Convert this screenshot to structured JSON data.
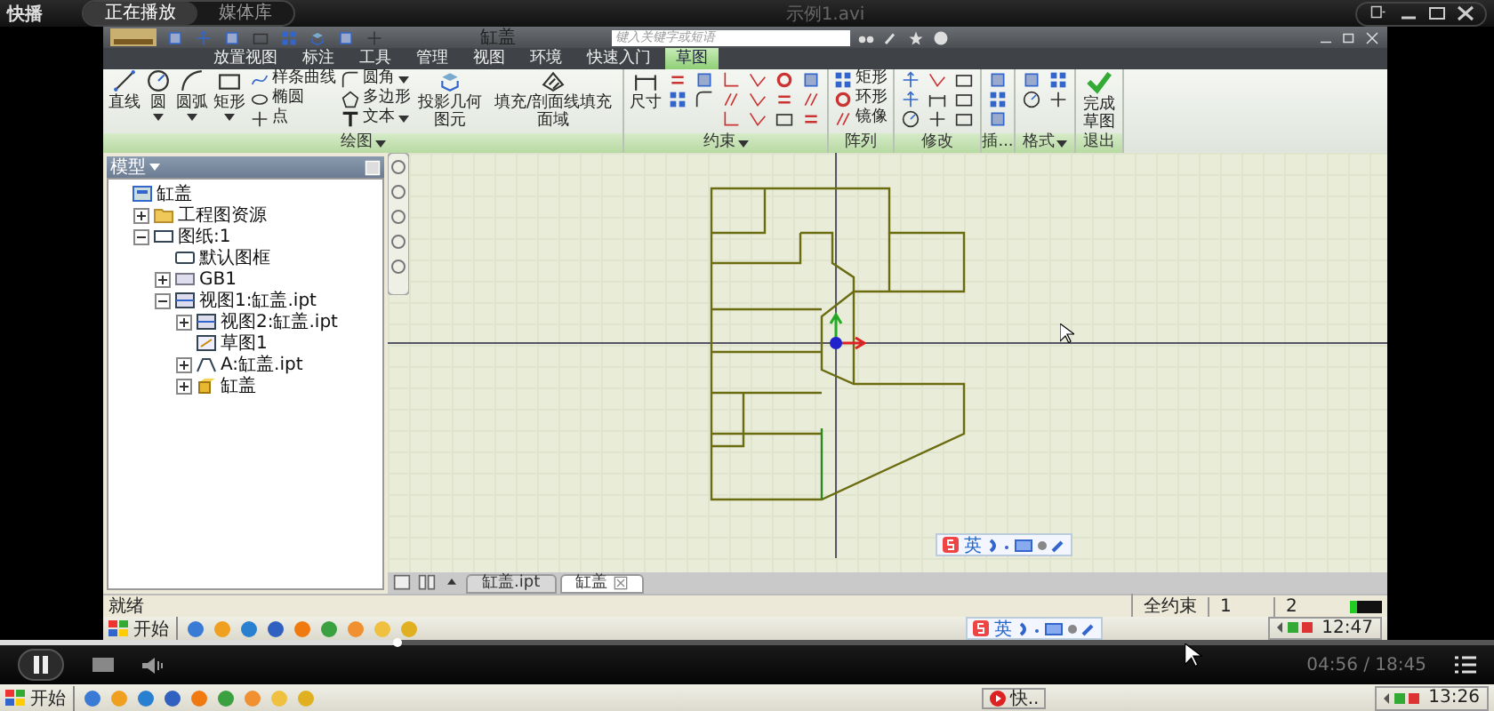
{
  "player": {
    "logo": "快播",
    "tabs": [
      {
        "label": "正在播放",
        "selected": true
      },
      {
        "label": "媒体库",
        "selected": false
      }
    ],
    "title": "示例1.avi"
  },
  "app": {
    "title": "缸盖",
    "search": {
      "placeholder": "键入关键字或短语"
    },
    "ribbon_tabs": [
      {
        "label": "放置视图",
        "selected": false
      },
      {
        "label": "标注",
        "selected": false
      },
      {
        "label": "工具",
        "selected": false
      },
      {
        "label": "管理",
        "selected": false
      },
      {
        "label": "视图",
        "selected": false
      },
      {
        "label": "环境",
        "selected": false
      },
      {
        "label": "快速入门",
        "selected": false
      },
      {
        "label": "草图",
        "selected": true
      }
    ],
    "ribbon_groups": [
      {
        "kind": "draw",
        "label": "绘图",
        "menu": true,
        "tools": [
          {
            "kind": "large",
            "label": "直线",
            "menu": false
          },
          {
            "kind": "large",
            "label": "圆",
            "menu": true
          },
          {
            "kind": "large",
            "label": "圆弧",
            "menu": true
          },
          {
            "kind": "large",
            "label": "矩形",
            "menu": true
          },
          {
            "kind": "small",
            "label": "样条曲线",
            "menu": false
          },
          {
            "kind": "small",
            "label": "椭圆",
            "menu": false
          },
          {
            "kind": "small",
            "label": "点",
            "menu": false
          },
          {
            "kind": "small",
            "label": "圆角",
            "menu": true
          },
          {
            "kind": "small",
            "label": "多边形",
            "menu": false
          },
          {
            "kind": "small",
            "label": "文本",
            "menu": true
          },
          {
            "kind": "large",
            "label": "投影几何图元",
            "menu": false
          },
          {
            "kind": "large",
            "label": "填充/剖面线填充面域",
            "menu": false
          }
        ]
      },
      {
        "kind": "constraint",
        "label": "约束",
        "menu": true,
        "tools": [
          {
            "kind": "large",
            "label": "尺寸",
            "menu": false
          }
        ]
      },
      {
        "kind": "pattern",
        "label": "阵列",
        "menu": false,
        "tools": [
          {
            "kind": "small",
            "label": "矩形",
            "menu": false
          },
          {
            "kind": "small",
            "label": "环形",
            "menu": false
          },
          {
            "kind": "small",
            "label": "镜像",
            "menu": false
          }
        ]
      },
      {
        "kind": "modify",
        "label": "修改",
        "menu": false
      },
      {
        "kind": "insert",
        "label": "插...",
        "menu": false
      },
      {
        "kind": "format",
        "label": "格式",
        "menu": true
      },
      {
        "kind": "exit",
        "label": "退出",
        "menu": false,
        "tools": [
          {
            "kind": "large",
            "label": "完成草图",
            "menu": false
          }
        ]
      }
    ],
    "browser": {
      "title": "模型",
      "tree": [
        {
          "kind": "part",
          "label": "缸盖",
          "children": [
            {
              "kind": "folder",
              "label": "工程图资源",
              "expanded": false
            },
            {
              "kind": "sheet",
              "label": "图纸:1",
              "expanded": true,
              "children": [
                {
                  "kind": "frame",
                  "label": "默认图框"
                },
                {
                  "kind": "standard",
                  "label": "GB1",
                  "expanded": false
                },
                {
                  "kind": "view",
                  "label": "视图1:缸盖.ipt",
                  "expanded": true,
                  "children": [
                    {
                      "kind": "view",
                      "label": "视图2:缸盖.ipt",
                      "expanded": false
                    },
                    {
                      "kind": "sketch",
                      "label": "草图1"
                    },
                    {
                      "kind": "section",
                      "label": "A:缸盖.ipt",
                      "expanded": false
                    },
                    {
                      "kind": "solid",
                      "label": "缸盖",
                      "expanded": false
                    }
                  ]
                }
              ]
            }
          ]
        }
      ]
    },
    "doc_tabs": [
      {
        "label": "缸盖.ipt",
        "selected": false
      },
      {
        "label": "缸盖",
        "selected": true
      }
    ],
    "status": {
      "text": "就绪",
      "cells": [
        "全约束",
        "1",
        "2"
      ]
    },
    "taskbar": {
      "start": "开始",
      "clock": "12:47"
    },
    "ime_bars": [
      {
        "label": "英"
      },
      {
        "label": "英"
      }
    ]
  },
  "controls": {
    "progress": {
      "level": 0.265
    },
    "time": "04:56 / 18:45"
  },
  "taskbar": {
    "start": "开始",
    "task": "快..",
    "clock": "13:26"
  }
}
